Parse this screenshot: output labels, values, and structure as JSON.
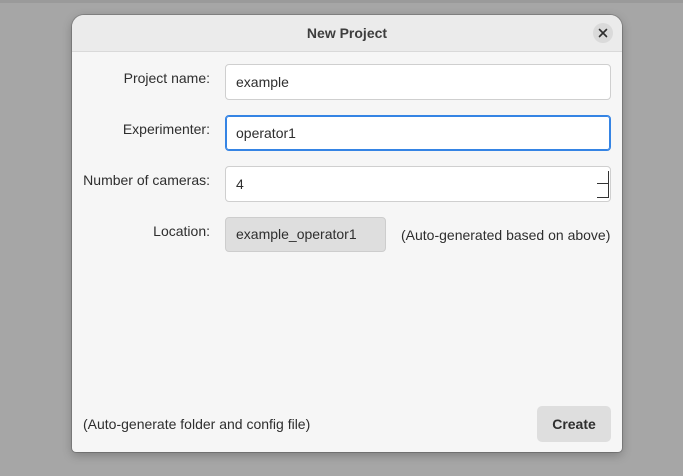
{
  "dialog": {
    "title": "New Project",
    "close_icon": "close-icon"
  },
  "form": {
    "project_name": {
      "label": "Project name:",
      "value": "example"
    },
    "experimenter": {
      "label": "Experimenter:",
      "value": "operator1"
    },
    "num_cameras": {
      "label": "Number of cameras:",
      "value": "4"
    },
    "location": {
      "label": "Location:",
      "value": "example_operator1",
      "hint": "(Auto-generated based on above)"
    }
  },
  "footer": {
    "note": "(Auto-generate folder and config file)",
    "create_label": "Create"
  },
  "colors": {
    "focus_accent": "#3584e4",
    "dialog_bg": "#f6f6f6",
    "backdrop": "#a6a6a6"
  }
}
